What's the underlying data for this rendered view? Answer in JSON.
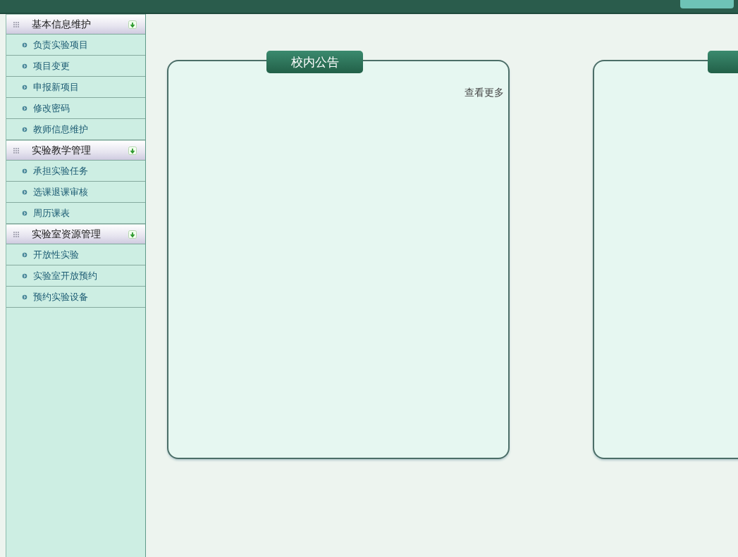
{
  "sidebar": {
    "groups": [
      {
        "title": "基本信息维护",
        "expanded": true,
        "items": [
          "负责实验项目",
          "项目变更",
          "申报新项目",
          "修改密码",
          "教师信息维护"
        ]
      },
      {
        "title": "实验教学管理",
        "expanded": true,
        "items": [
          "承担实验任务",
          "选课退课审核",
          "周历课表"
        ]
      },
      {
        "title": "实验室资源管理",
        "expanded": true,
        "items": [
          "开放性实验",
          "实验室开放预约",
          "预约实验设备"
        ]
      }
    ]
  },
  "panels": [
    {
      "title": "校内公告",
      "more_link": "查看更多"
    }
  ]
}
